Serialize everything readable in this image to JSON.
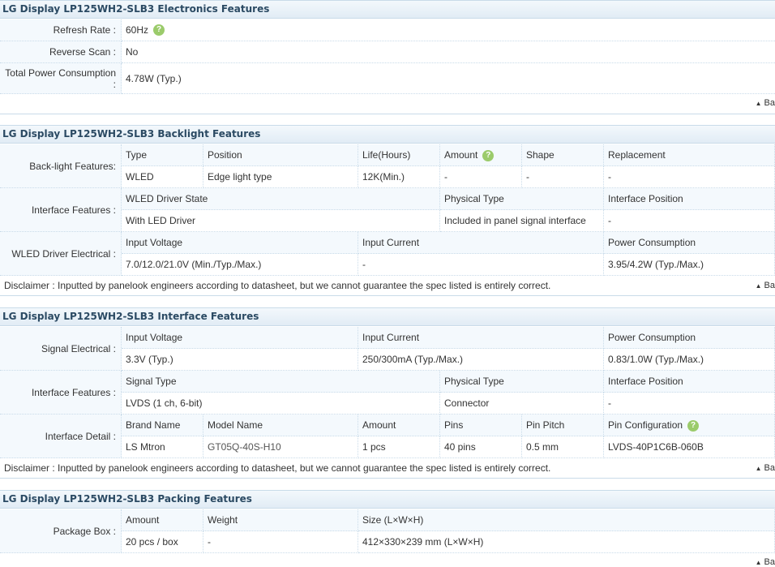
{
  "electronics": {
    "title": "LG Display LP125WH2-SLB3 Electronics Features",
    "refresh_label": "Refresh Rate :",
    "refresh_value": "60Hz",
    "reverse_label": "Reverse Scan :",
    "reverse_value": "No",
    "power_label_1": "Total Power Consumption",
    "power_label_2": ":",
    "power_value": "4.78W (Typ.)",
    "back": "Ba"
  },
  "backlight": {
    "title": "LG Display LP125WH2-SLB3 Backlight Features",
    "bl_label": "Back-light Features:",
    "bl_headers": [
      "Type",
      "Position",
      "Life(Hours)",
      "Amount",
      "Shape",
      "Replacement"
    ],
    "bl_values": [
      "WLED",
      "Edge light type",
      "12K(Min.)",
      "-",
      "-",
      "-"
    ],
    "if_label": "Interface Features :",
    "if_headers": [
      "WLED Driver State",
      "Physical Type",
      "Interface Position"
    ],
    "if_values": [
      "With LED Driver",
      "Included in panel signal interface",
      "-"
    ],
    "de_label": "WLED Driver Electrical :",
    "de_headers": [
      "Input Voltage",
      "Input Current",
      "Power Consumption"
    ],
    "de_values": [
      "7.0/12.0/21.0V (Min./Typ./Max.)",
      "-",
      "3.95/4.2W (Typ./Max.)"
    ],
    "disclaimer": "Disclaimer : Inputted by panelook engineers according to datasheet, but we cannot guarantee the spec listed is entirely correct.",
    "back": "Ba"
  },
  "interface": {
    "title": "LG Display LP125WH2-SLB3 Interface Features",
    "se_label": "Signal Electrical :",
    "se_headers": [
      "Input Voltage",
      "Input Current",
      "Power Consumption"
    ],
    "se_values": [
      "3.3V (Typ.)",
      "250/300mA (Typ./Max.)",
      "0.83/1.0W (Typ./Max.)"
    ],
    "if_label": "Interface Features :",
    "if_headers": [
      "Signal Type",
      "Physical Type",
      "Interface Position"
    ],
    "if_values": [
      "LVDS (1 ch, 6-bit)",
      "Connector",
      "-"
    ],
    "id_label": "Interface Detail :",
    "id_headers": [
      "Brand Name",
      "Model Name",
      "Amount",
      "Pins",
      "Pin Pitch",
      "Pin Configuration"
    ],
    "id_values": [
      "LS Mtron",
      "GT05Q-40S-H10",
      "1 pcs",
      "40 pins",
      "0.5 mm",
      "LVDS-40P1C6B-060B"
    ],
    "disclaimer": "Disclaimer : Inputted by panelook engineers according to datasheet, but we cannot guarantee the spec listed is entirely correct.",
    "back": "Ba"
  },
  "packing": {
    "title": "LG Display LP125WH2-SLB3 Packing Features",
    "pb_label": "Package Box :",
    "pb_headers": [
      "Amount",
      "Weight",
      "Size (L×W×H)"
    ],
    "pb_values": [
      "20 pcs / box",
      "-",
      "412×330×239 mm (L×W×H)"
    ],
    "back": "Ba"
  },
  "help_glyph": "?",
  "back_icon": "triangle-up-icon",
  "colors": {
    "header_bg": "#e1ecf5",
    "header_text": "#2b4a63",
    "label_bg": "#f4f9fd",
    "help_green": "#9bcb6b"
  }
}
